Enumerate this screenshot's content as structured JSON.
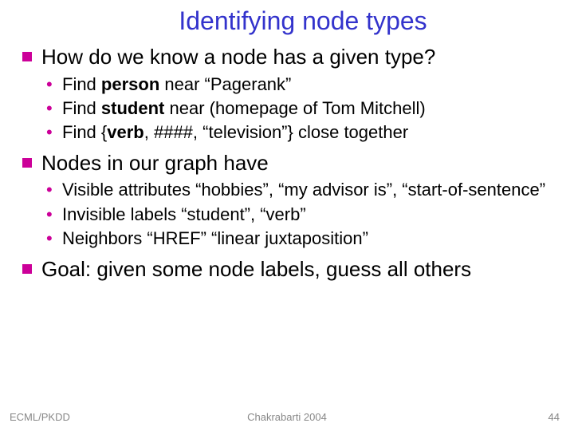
{
  "title": "Identifying node types",
  "tops": [
    {
      "text": "How do we know a node has a given type?"
    },
    {
      "text": "Nodes in our graph have"
    },
    {
      "text": "Goal: given some node labels, guess all others"
    }
  ],
  "subs1": [
    {
      "pre": "Find ",
      "bold": "person",
      "post": " near “Pagerank”"
    },
    {
      "pre": "Find ",
      "bold": "student",
      "post": " near (homepage of Tom Mitchell)"
    },
    {
      "pre": "Find {",
      "bold": "verb",
      "post": ", ####, “television”} close together"
    }
  ],
  "subs2": [
    {
      "text": "Visible attributes “hobbies”, “my advisor is”, “start-of-sentence”"
    },
    {
      "text": "Invisible labels “student”, “verb”"
    },
    {
      "text": "Neighbors “HREF” “linear juxtaposition”"
    }
  ],
  "footer": {
    "left": "ECML/PKDD",
    "center": "Chakrabarti 2004",
    "right": "44"
  }
}
